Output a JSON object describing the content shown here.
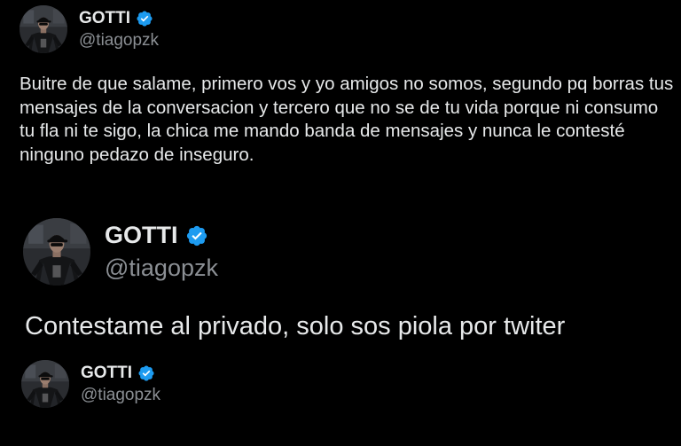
{
  "colors": {
    "background": "#000000",
    "text": "#e7e9ea",
    "handle": "#8b8f94",
    "verified": "#1d9bf0"
  },
  "tweets": [
    {
      "author": {
        "display_name": "GOTTI",
        "handle": "@tiagopzk",
        "verified_icon": "verified-badge-icon",
        "avatar_icon": "avatar-image"
      },
      "text": "Buitre de que salame, primero vos y yo amigos no somos, segundo pq borras tus mensajes de la conversacion y tercero que no se de tu vida porque ni consumo tu fla ni te sigo, la chica me mando banda de mensajes y nunca le contesté ninguno pedazo de inseguro."
    },
    {
      "author": {
        "display_name": "GOTTI",
        "handle": "@tiagopzk",
        "verified_icon": "verified-badge-icon",
        "avatar_icon": "avatar-image"
      },
      "text": "Contestame al privado, solo sos piola por twiter"
    },
    {
      "author": {
        "display_name": "GOTTI",
        "handle": "@tiagopzk",
        "verified_icon": "verified-badge-icon",
        "avatar_icon": "avatar-image"
      }
    }
  ]
}
